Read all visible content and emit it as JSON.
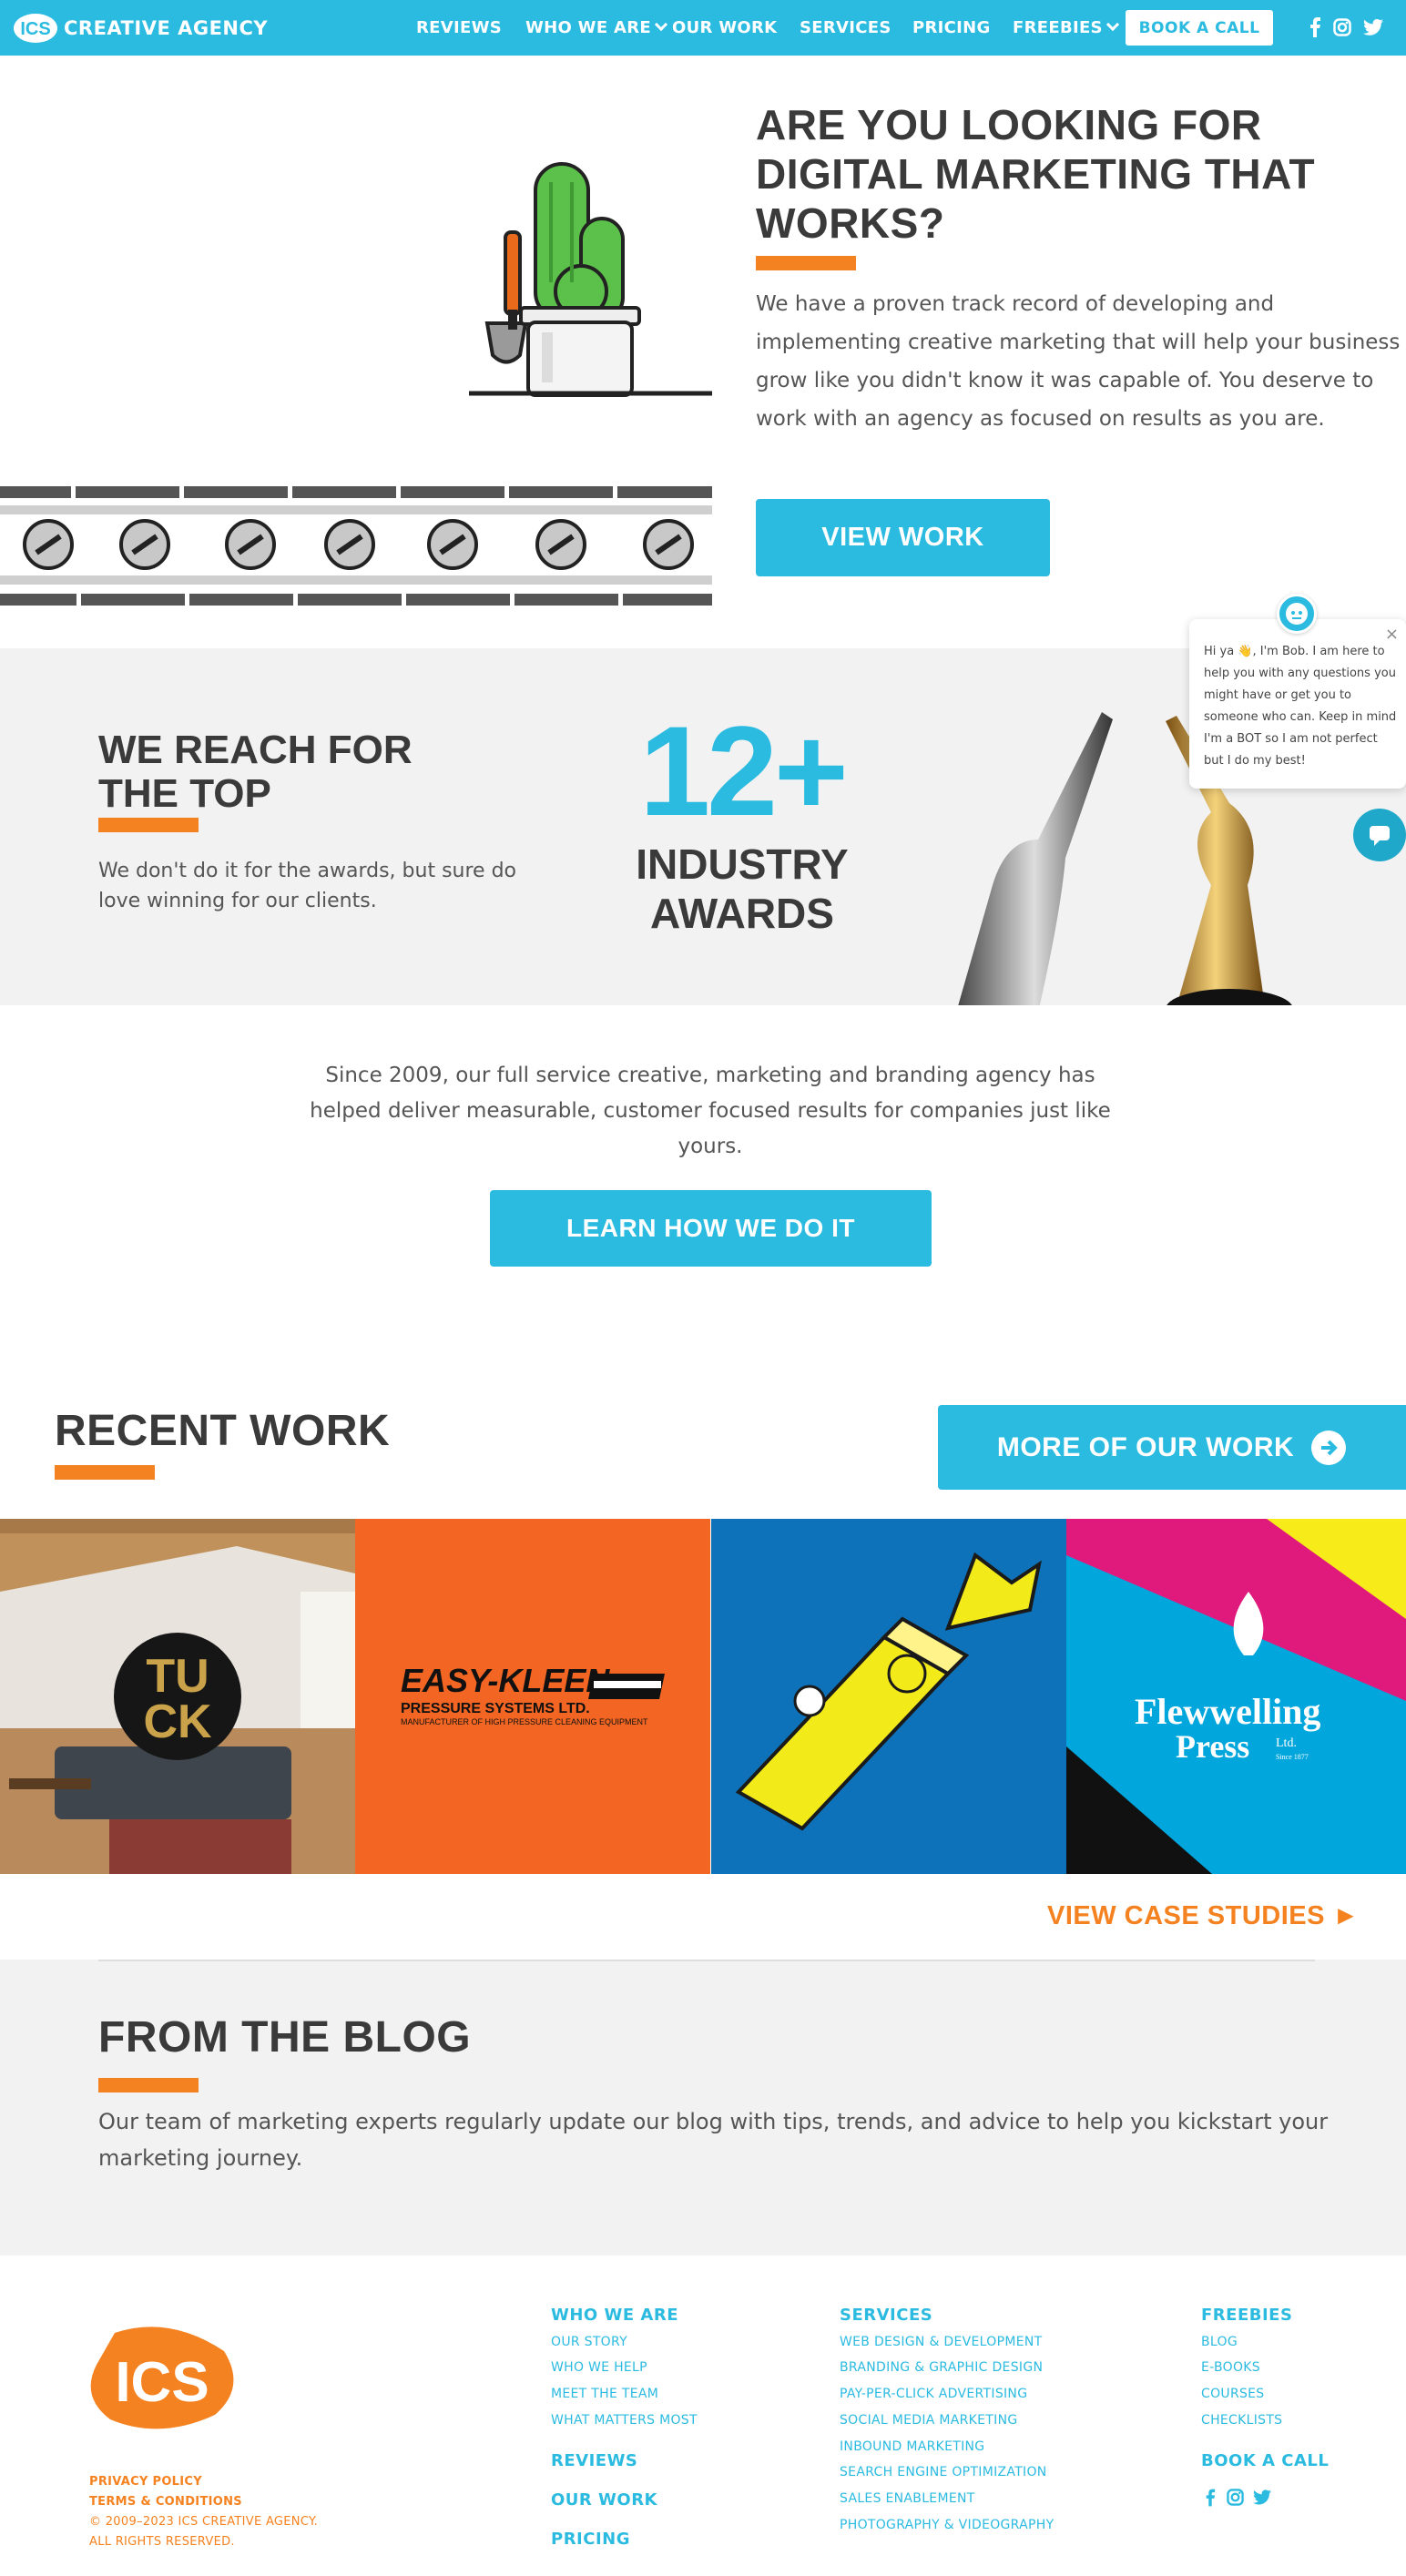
{
  "nav": {
    "logo_badge": "ICS",
    "logo_text": "CREATIVE AGENCY",
    "links": [
      "REVIEWS",
      "WHO WE ARE",
      "OUR WORK",
      "SERVICES",
      "PRICING",
      "FREEBIES"
    ],
    "cta": "BOOK A CALL",
    "social": [
      "facebook-icon",
      "instagram-icon",
      "twitter-icon"
    ]
  },
  "hero": {
    "title": "ARE YOU LOOKING FOR DIGITAL MARKETING THAT WORKS?",
    "body": "We have a proven track record of developing and implementing creative marketing that will help your business grow like you didn't know it was capable of. You deserve to work with an agency as focused on results as you are.",
    "button": "VIEW WORK"
  },
  "awards": {
    "title_line1": "WE REACH FOR",
    "title_line2": "THE TOP",
    "body": "We don't do it for the awards, but sure do love winning for our clients.",
    "count": "12+",
    "label_line1": "INDUSTRY",
    "label_line2": "AWARDS"
  },
  "chat": {
    "message": "Hi ya 👋, I'm Bob. I am here to help you with any questions you might have or get you to someone who can. Keep in mind I'm a BOT so I am not perfect but I do my best!",
    "close": "×"
  },
  "since": {
    "body": "Since 2009, our full service creative, marketing and branding agency has helped deliver measurable, customer focused results for companies just like yours.",
    "button": "LEARN HOW WE DO IT"
  },
  "recent_work": {
    "title": "RECENT WORK",
    "more_button": "MORE OF OUR WORK",
    "tiles": {
      "tuck_line1": "TU",
      "tuck_line2": "CK",
      "easykleen_name": "EASY-KLEEN",
      "easykleen_sub": "PRESSURE SYSTEMS LTD.",
      "easykleen_tag": "MANUFACTURER OF HIGH PRESSURE CLEANING EQUIPMENT",
      "flew_line1": "Flewwelling",
      "flew_line2": "Press",
      "flew_ltd": "Ltd.",
      "flew_since": "Since 1877"
    },
    "case_link": "VIEW CASE STUDIES ►"
  },
  "blog": {
    "title": "FROM THE BLOG",
    "body": "Our team of marketing experts regularly update our blog with tips, trends, and advice to help you kickstart your marketing journey."
  },
  "footer": {
    "logo": "ICS",
    "who": {
      "heading": "WHO WE ARE",
      "links": [
        "OUR STORY",
        "WHO WE HELP",
        "MEET THE TEAM",
        "WHAT MATTERS MOST"
      ]
    },
    "reviews": "REVIEWS",
    "our_work": "OUR WORK",
    "pricing": "PRICING",
    "services": {
      "heading": "SERVICES",
      "links": [
        "WEB DESIGN & DEVELOPMENT",
        "BRANDING & GRAPHIC DESIGN",
        "PAY-PER-CLICK ADVERTISING",
        "SOCIAL MEDIA MARKETING",
        "INBOUND MARKETING",
        "SEARCH ENGINE OPTIMIZATION",
        "SALES ENABLEMENT",
        "PHOTOGRAPHY & VIDEOGRAPHY"
      ]
    },
    "freebies": {
      "heading": "FREEBIES",
      "links": [
        "BLOG",
        "E-BOOKS",
        "COURSES",
        "CHECKLISTS"
      ]
    },
    "book_call": "BOOK A CALL",
    "legal": {
      "privacy": "PRIVACY POLICY",
      "terms": "TERMS & CONDITIONS",
      "copyright": "© 2009–2023 ICS CREATIVE AGENCY.",
      "rights": "ALL RIGHTS RESERVED."
    }
  },
  "colors": {
    "brand_blue": "#2bbbe0",
    "brand_orange": "#f58220",
    "dark_text": "#3a3a3a"
  }
}
